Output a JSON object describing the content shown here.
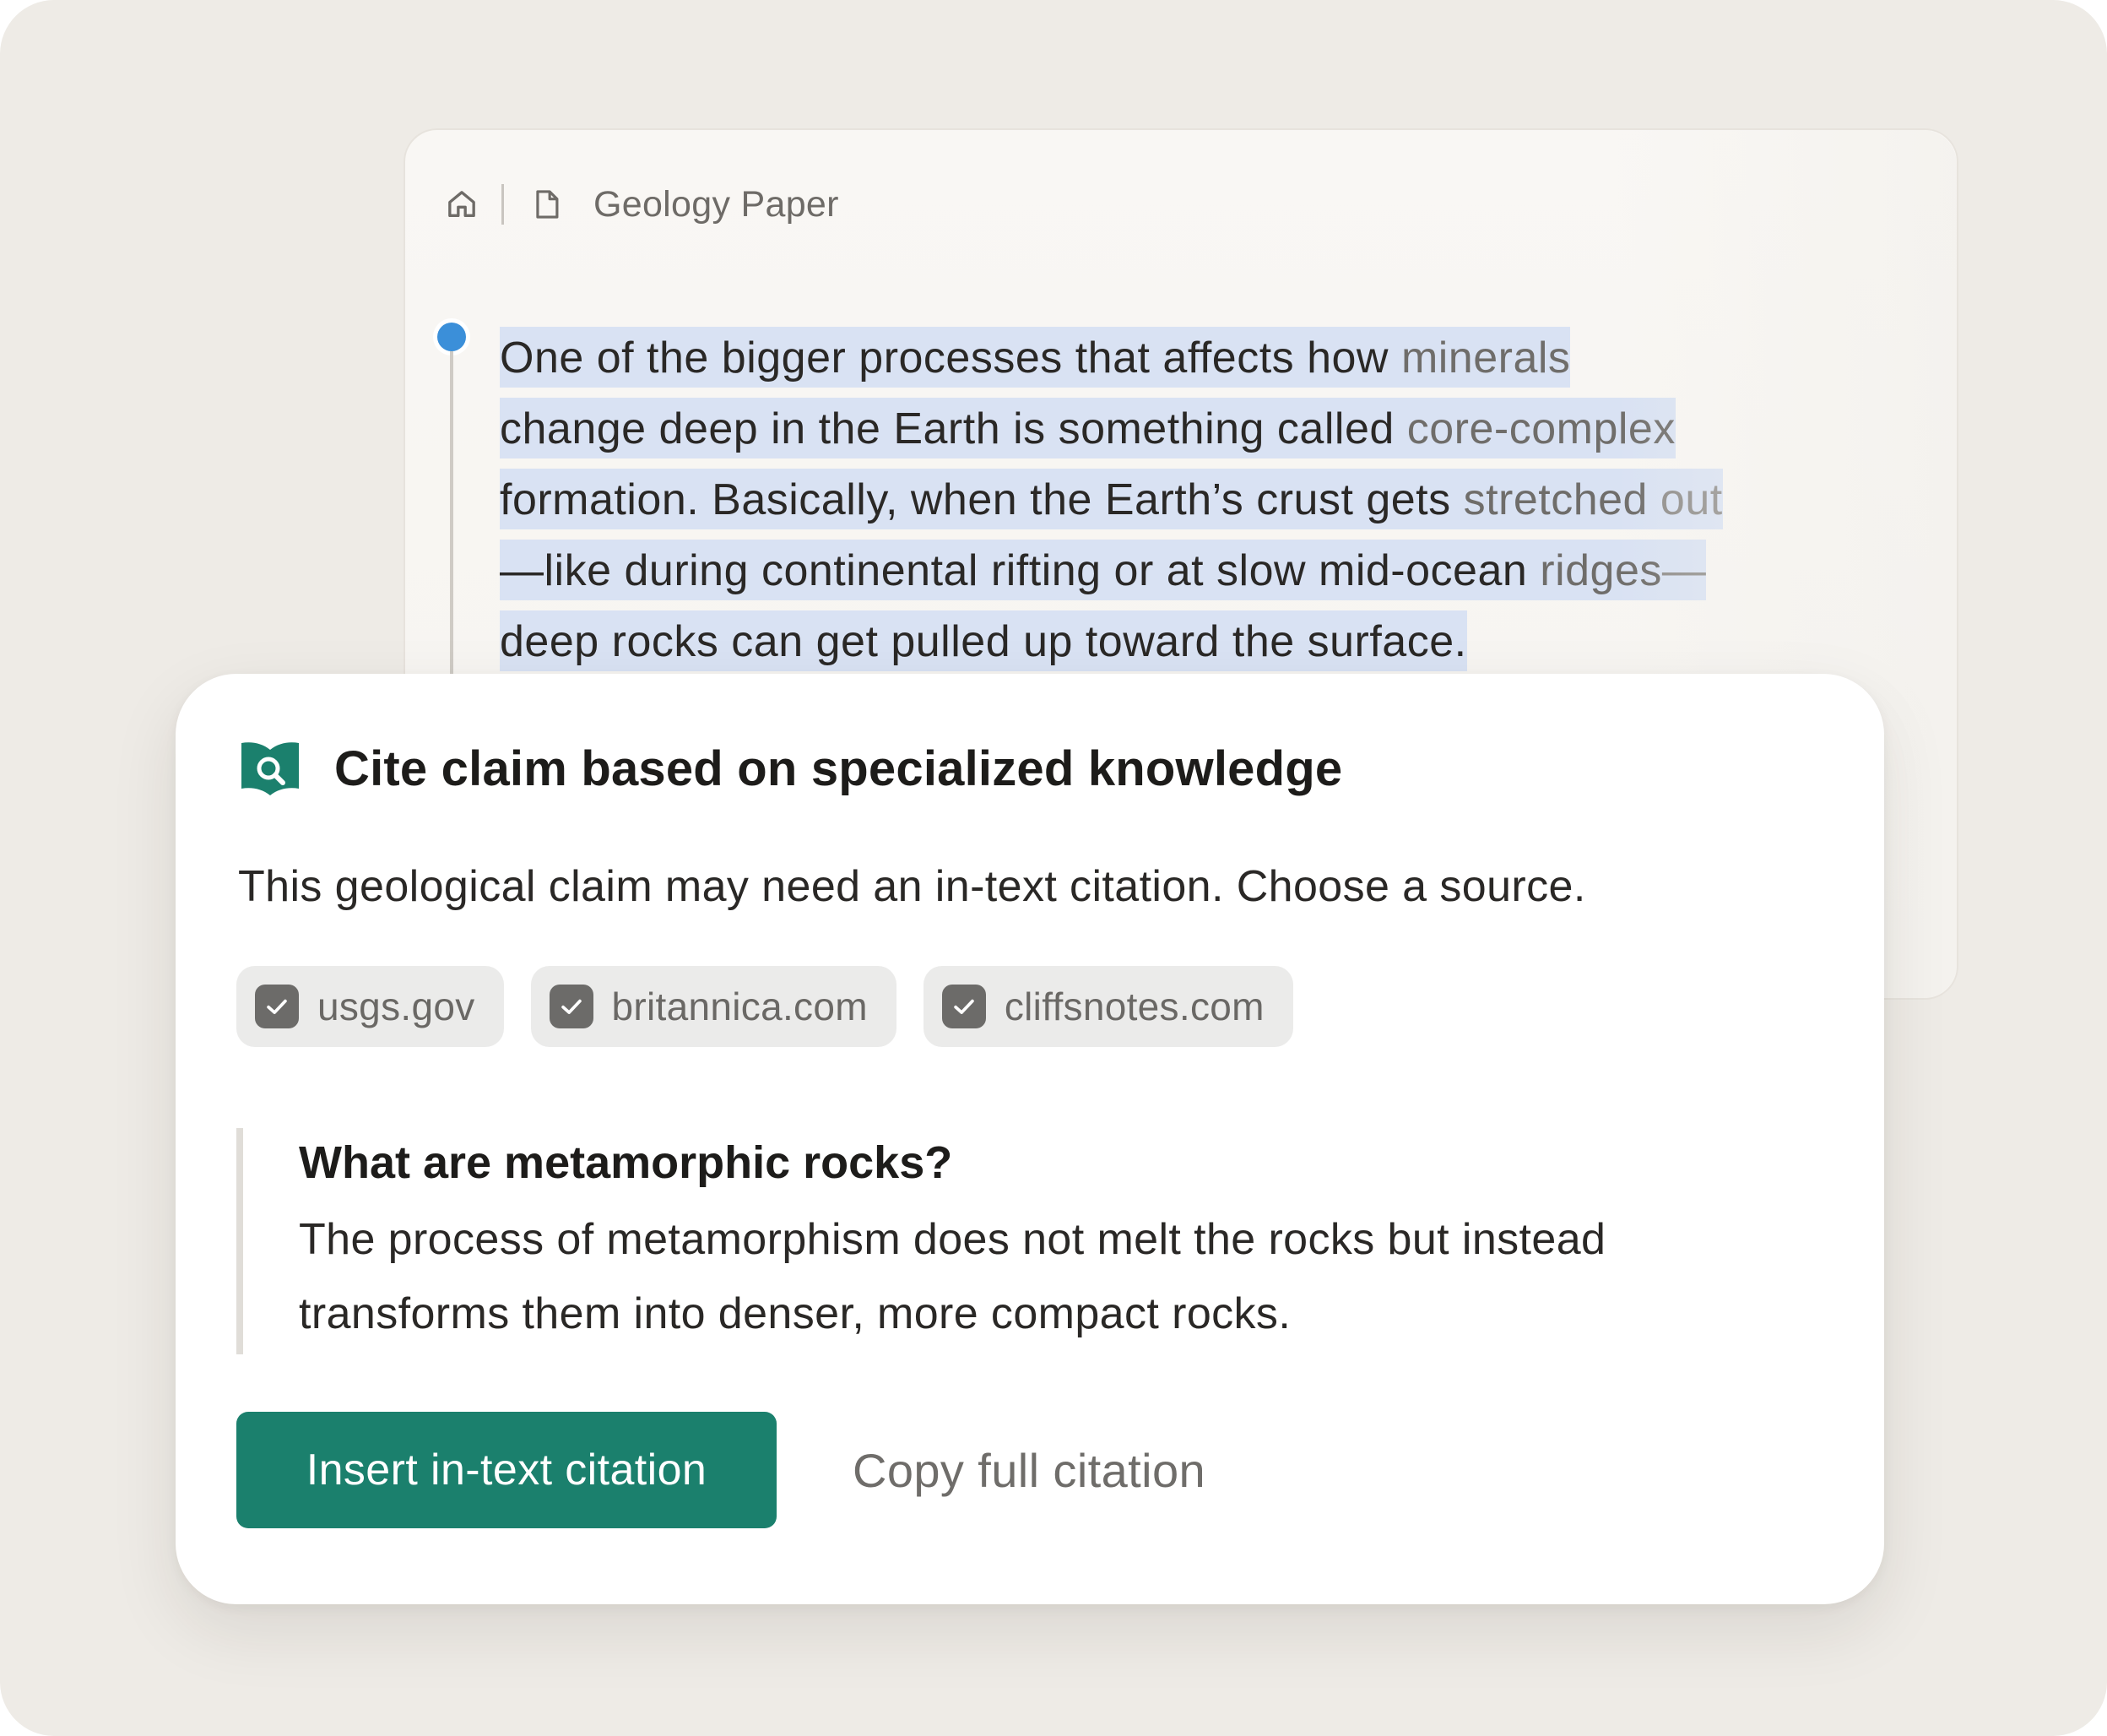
{
  "breadcrumb": {
    "home_icon": "home-icon",
    "doc_icon": "document-icon",
    "title": "Geology Paper"
  },
  "document": {
    "lines": [
      {
        "main": "One of the bigger processes that affects how ",
        "fade": "minerals",
        "fade2": ""
      },
      {
        "main": "change deep in the Earth is something called ",
        "fade": "core-complex",
        "fade2": ""
      },
      {
        "main": "formation. Basically, when the Earth’s crust gets ",
        "fade": "stretched ",
        "fade2": "out"
      },
      {
        "main": "—like during continental rifting or at slow mid-ocean ",
        "fade": "ridges",
        "fade2": "—"
      },
      {
        "main": "deep rocks can get pulled up toward the surface.",
        "fade": "",
        "fade2": ""
      }
    ]
  },
  "card": {
    "icon": "book-search-icon",
    "title": "Cite claim based on specialized knowledge",
    "description": "This geological claim may need an in-text citation. Choose a source.",
    "sources": [
      {
        "label": "usgs.gov",
        "checked": true
      },
      {
        "label": "britannica.com",
        "checked": true
      },
      {
        "label": "cliffsnotes.com",
        "checked": true
      }
    ],
    "quote": {
      "title": "What are metamorphic rocks?",
      "body": "The process of metamorphism does not melt the rocks but instead transforms them into denser, more compact rocks."
    },
    "primary_button": "Insert in-text citation",
    "secondary_button": "Copy full citation"
  },
  "colors": {
    "accent": "#1b806d",
    "highlight": "#d9e2f3",
    "dot": "#3b8fd9",
    "background": "#eeebe6"
  }
}
